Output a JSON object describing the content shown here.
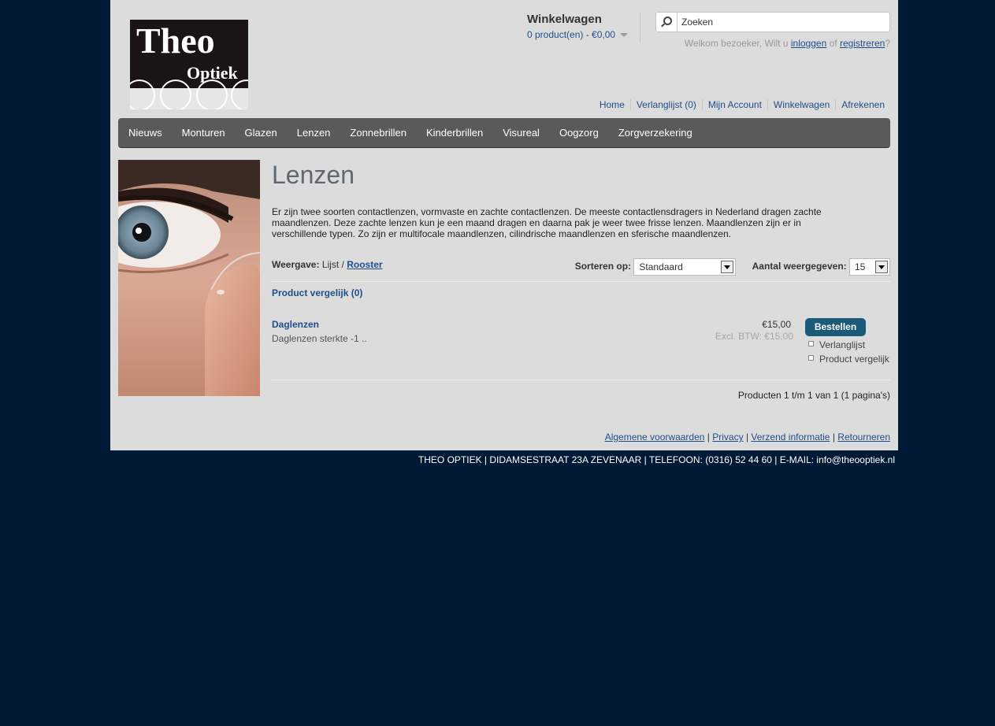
{
  "logo": {
    "line1": "Theo",
    "line2": "Optiek"
  },
  "cart": {
    "title": "Winkelwagen",
    "summary": "0 product(en) - €0,00"
  },
  "search": {
    "value": "Zoeken"
  },
  "welcome": {
    "prefix": "Welkom bezoeker, Wilt u",
    "login": "inloggen",
    "or": "of",
    "register": "registreren",
    "suffix": "?"
  },
  "toplinks": [
    "Home",
    "Verlanglijst (0)",
    "Mijn Account",
    "Winkelwagen",
    "Afrekenen"
  ],
  "nav": [
    "Nieuws",
    "Monturen",
    "Glazen",
    "Lenzen",
    "Zonnebrillen",
    "Kinderbrillen",
    "Visureal",
    "Oogzorg",
    "Zorgverzekering"
  ],
  "category": {
    "title": "Lenzen",
    "description": "Er zijn twee soorten contactlenzen, vormvaste en zachte contactlenzen. De meeste contactlensdragers in Nederland dragen zachte maandlenzen. Deze zachte lenzen kun je een maand dragen en daarna pak je weer twee frisse lenzen. Maandlenzen zijn er in verschillende typen. Zo zijn er multifocale maandlenzen, cilindrische maandlenzen en sferische maandlenzen."
  },
  "display": {
    "label": "Weergave:",
    "list": "Lijst",
    "sep": "/",
    "grid": "Rooster"
  },
  "sort": {
    "label": "Sorteren op:",
    "value": "Standaard"
  },
  "limit": {
    "label": "Aantal weergegeven:",
    "value": "15"
  },
  "compare": "Product vergelijk (0)",
  "product": {
    "name": "Daglenzen",
    "description": "Daglenzen sterkte -1 ..",
    "price": "€15,00",
    "price_ex": "Excl. BTW: €15,00",
    "buy": "Bestellen",
    "wishlist": "Verlanglijst",
    "compare": "Product vergelijk"
  },
  "pagination": "Producten 1 t/m 1 van 1 (1 pagina's)",
  "footer_links": [
    "Algemene voorwaarden",
    "Privacy",
    "Verzend informatie",
    "Retourneren"
  ],
  "footer_sep": "|",
  "bottom_text": "THEO OPTIEK | DIDAMSESTRAAT 23A ZEVENAAR | TELEFOON: (0316) 52 44 60 | E-MAIL: info@theooptiek.nl"
}
